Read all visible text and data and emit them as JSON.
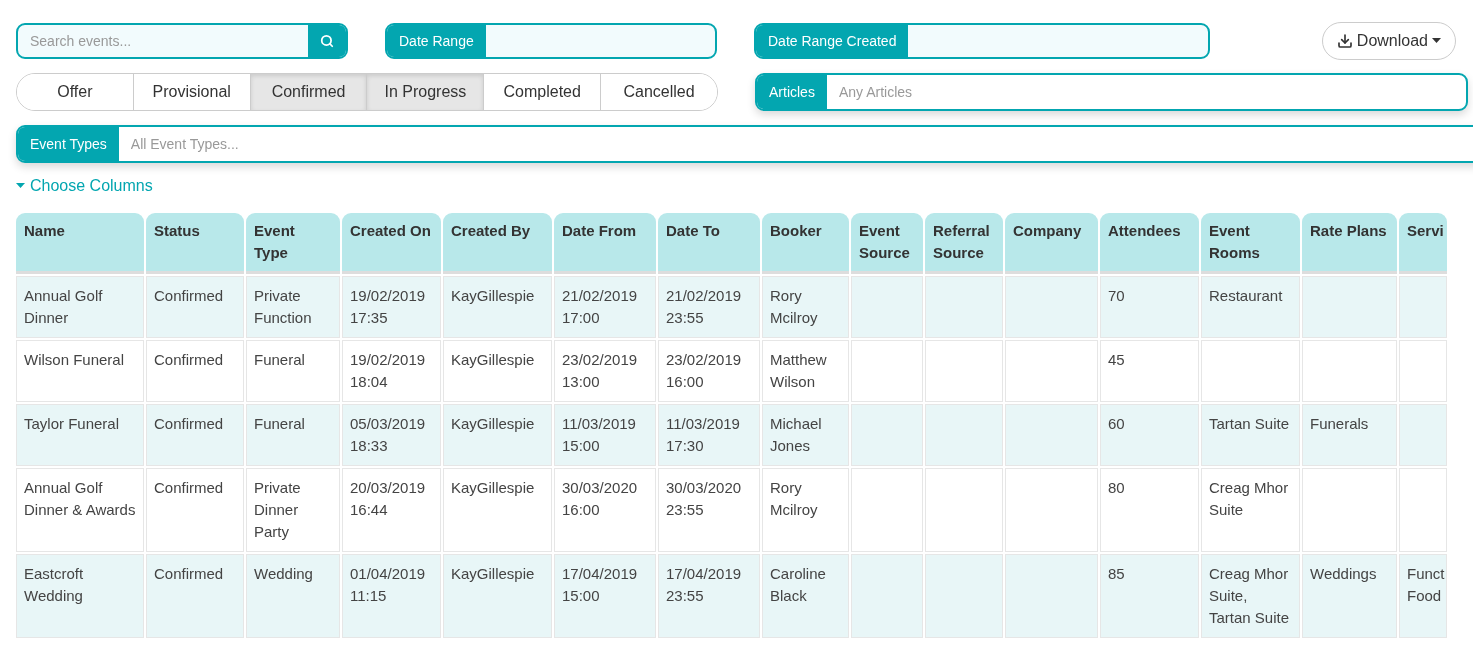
{
  "search": {
    "placeholder": "Search events..."
  },
  "date_range": {
    "label": "Date Range"
  },
  "date_range_created": {
    "label": "Date Range Created"
  },
  "download": {
    "label": "Download"
  },
  "status_filters": [
    {
      "label": "Offer",
      "selected": false
    },
    {
      "label": "Provisional",
      "selected": false
    },
    {
      "label": "Confirmed",
      "selected": true
    },
    {
      "label": "In Progress",
      "selected": true
    },
    {
      "label": "Completed",
      "selected": false
    },
    {
      "label": "Cancelled",
      "selected": false
    }
  ],
  "articles": {
    "label": "Articles",
    "placeholder": "Any Articles"
  },
  "event_types": {
    "label": "Event Types",
    "placeholder": "All Event Types..."
  },
  "choose_columns": {
    "label": "Choose Columns",
    "expanded": true
  },
  "table": {
    "columns": [
      "Name",
      "Status",
      "Event Type",
      "Created On",
      "Created By",
      "Date From",
      "Date To",
      "Booker",
      "Event Source",
      "Referral Source",
      "Company",
      "Attendees",
      "Event Rooms",
      "Rate Plans",
      "Servi"
    ],
    "rows": [
      [
        "Annual Golf Dinner",
        "Confirmed",
        "Private Function",
        "19/02/2019 17:35",
        "KayGillespie",
        "21/02/2019 17:00",
        "21/02/2019 23:55",
        "Rory Mcilroy",
        null,
        null,
        null,
        "70",
        "Restaurant",
        null,
        null
      ],
      [
        "Wilson Funeral",
        "Confirmed",
        "Funeral",
        "19/02/2019 18:04",
        "KayGillespie",
        "23/02/2019 13:00",
        "23/02/2019 16:00",
        "Matthew Wilson",
        null,
        null,
        null,
        "45",
        null,
        null,
        null
      ],
      [
        "Taylor Funeral",
        "Confirmed",
        "Funeral",
        "05/03/2019 18:33",
        "KayGillespie",
        "11/03/2019 15:00",
        "11/03/2019 17:30",
        "Michael Jones",
        null,
        null,
        null,
        "60",
        "Tartan Suite",
        "Funerals",
        null
      ],
      [
        "Annual Golf Dinner & Awards",
        "Confirmed",
        "Private Dinner Party",
        "20/03/2019 16:44",
        "KayGillespie",
        "30/03/2020 16:00",
        "30/03/2020 23:55",
        "Rory Mcilroy",
        null,
        null,
        null,
        "80",
        "Creag Mhor Suite",
        null,
        null
      ],
      [
        "Eastcroft Wedding",
        "Confirmed",
        "Wedding",
        "01/04/2019 11:15",
        "KayGillespie",
        "17/04/2019 15:00",
        "17/04/2019 23:55",
        "Caroline Black",
        null,
        null,
        null,
        "85",
        "Creag Mhor Suite, Tartan Suite",
        "Weddings",
        "Funct Food"
      ]
    ]
  }
}
